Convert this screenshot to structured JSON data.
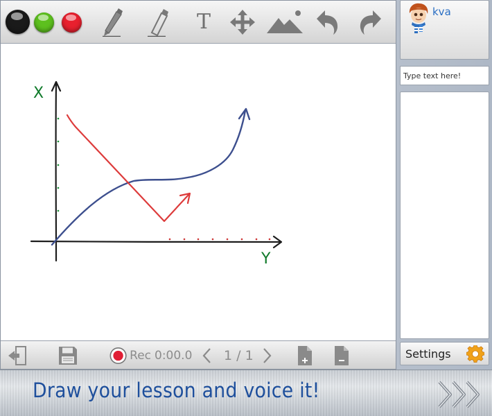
{
  "toolbar": {
    "colors": [
      {
        "name": "black",
        "hex": "#1a1a1a"
      },
      {
        "name": "green",
        "hex": "#5dc01e"
      },
      {
        "name": "red",
        "hex": "#e8202e"
      }
    ],
    "tools": [
      "pencil-icon",
      "eraser-icon",
      "text-icon",
      "move-icon",
      "image-icon",
      "undo-icon",
      "redo-icon"
    ],
    "text_tool_glyph": "T"
  },
  "canvas": {
    "labels": {
      "x_axis": "X",
      "y_axis": "Y"
    },
    "colors": {
      "axes": "#1c1c1c",
      "blue_curve": "#3d4f8e",
      "red_line": "#dd3b3b",
      "labels": "#0f7a2a",
      "ticks": "#1f8f3a",
      "tick_red": "#cc3333"
    }
  },
  "bottombar": {
    "rec_label": "Rec",
    "timer": "0:00.0",
    "page_indicator": "1 / 1"
  },
  "user": {
    "name": "kva"
  },
  "chat": {
    "placeholder": "Type text here!"
  },
  "settings": {
    "label": "Settings"
  },
  "banner": {
    "slogan": "Draw your lesson and voice it!"
  }
}
